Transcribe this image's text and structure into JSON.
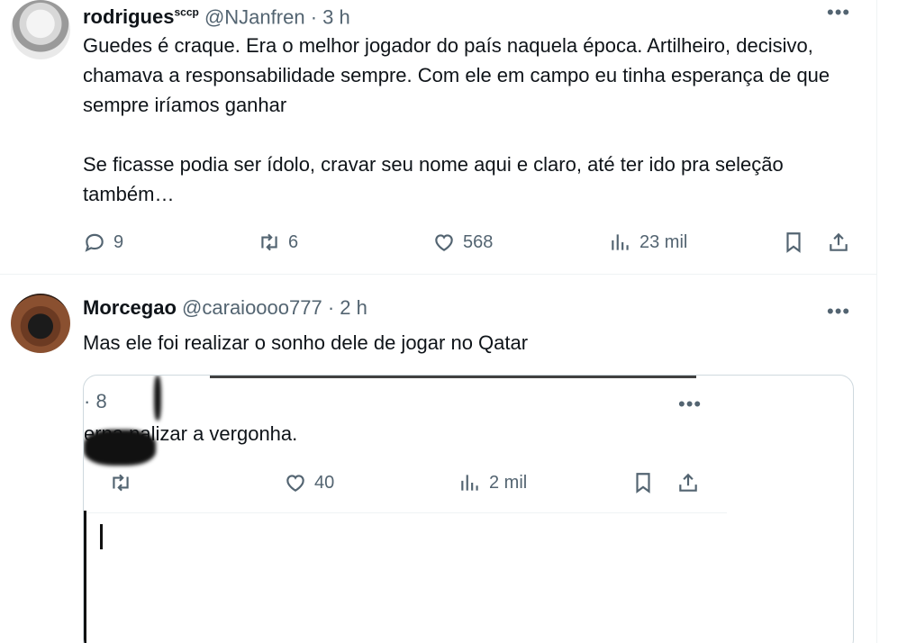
{
  "tweets": [
    {
      "name": "rodrigues",
      "name_sup": "sccp",
      "handle": "@NJanfren",
      "separator": "·",
      "time": "3 h",
      "text": [
        "Guedes é craque. Era o melhor jogador do país naquela época. Artilheiro, decisivo, chamava a responsabilidade sempre. Com ele em campo eu tinha esperança de que sempre iríamos ganhar",
        "Se ficasse podia ser ídolo, cravar seu nome aqui e claro, até ter ido pra seleção também…"
      ],
      "actions": {
        "reply_count": "9",
        "retweet_count": "6",
        "like_count": "568",
        "views_count": "23 mil"
      }
    },
    {
      "name": "Morcegao",
      "handle": "@caraioooo777",
      "separator": "·",
      "time": "2 h",
      "text": "Mas ele foi realizar o sonho dele de jogar no Qatar",
      "quoted": {
        "partial_number": "· 8",
        "text": "erna  nalizar a vergonha.",
        "actions": {
          "like_count": "40",
          "views_count": "2 mil"
        }
      }
    }
  ],
  "icons": {
    "more": "more-horizontal-icon",
    "reply": "reply-icon",
    "retweet": "retweet-icon",
    "like": "heart-icon",
    "views": "bar-chart-icon",
    "bookmark": "bookmark-icon",
    "share": "share-icon"
  },
  "colors": {
    "text": "#0f1419",
    "secondary": "#536471",
    "border": "#eff3f4",
    "card_border": "#cfd9de"
  }
}
